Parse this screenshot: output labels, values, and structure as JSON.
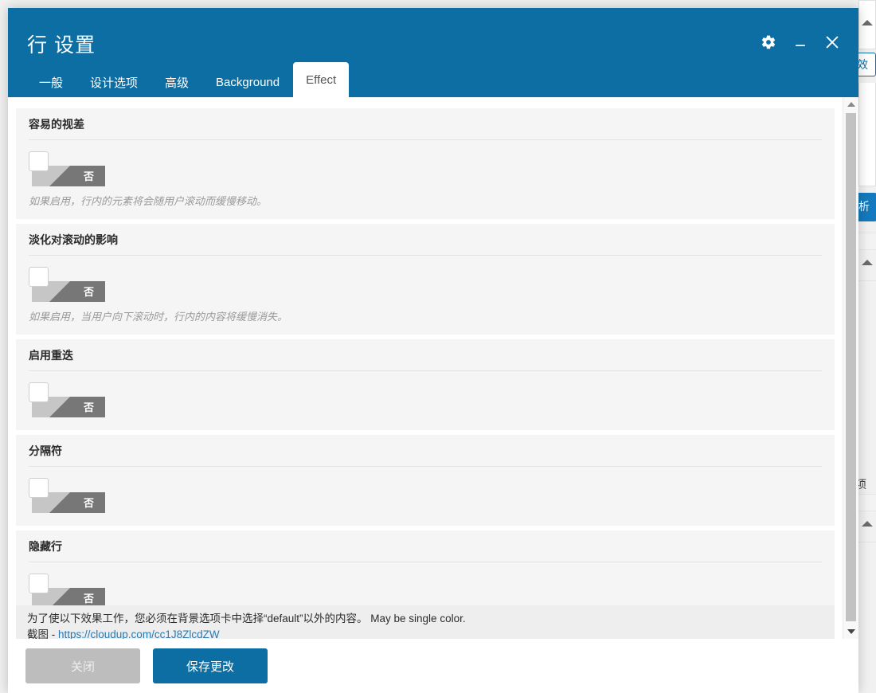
{
  "modal": {
    "title": "行 设置",
    "header_controls": [
      {
        "name": "gear-icon",
        "label": "设置"
      },
      {
        "name": "minimize-icon",
        "label": "最小化"
      },
      {
        "name": "close-icon",
        "label": "关闭"
      }
    ],
    "tabs": [
      {
        "label": "一般",
        "active": false
      },
      {
        "label": "设计选项",
        "active": false
      },
      {
        "label": "高级",
        "active": false
      },
      {
        "label": "Background",
        "active": false
      },
      {
        "label": "Effect",
        "active": true
      }
    ],
    "sections": [
      {
        "label": "容易的视差",
        "toggle_value": "否",
        "description": "如果启用，行内的元素将会随用户滚动而缓慢移动。"
      },
      {
        "label": "淡化对滚动的影响",
        "toggle_value": "否",
        "description": "如果启用，当用户向下滚动时，行内的内容将缓慢消失。"
      },
      {
        "label": "启用重迭",
        "toggle_value": "否",
        "description": ""
      },
      {
        "label": "分隔符",
        "toggle_value": "否",
        "description": ""
      },
      {
        "label": "隐藏行",
        "toggle_value": "否",
        "description": ""
      }
    ],
    "notice": {
      "line1": "为了使以下效果工作，您必须在背景选项卡中选择“default”以外的内容。 May be single color.",
      "prefix2": "截图 - ",
      "link_text": "https://cloudup.com/cc1J8ZlcdZW"
    },
    "footer": {
      "close_label": "关闭",
      "save_label": "保存更改"
    }
  },
  "background_page": {
    "fragments": [
      {
        "text": "效"
      },
      {
        "text": "析"
      },
      {
        "text": "项"
      }
    ]
  },
  "colors": {
    "header_blue": "#0d6ea3",
    "primary_button": "#0d6ea3",
    "close_button": "#bdbdbd",
    "link": "#2a7ab0",
    "toggle_track": "#c6c6c6",
    "toggle_fill": "#777777",
    "section_bg": "#f5f5f5",
    "notice_bg": "#eeeeee"
  }
}
